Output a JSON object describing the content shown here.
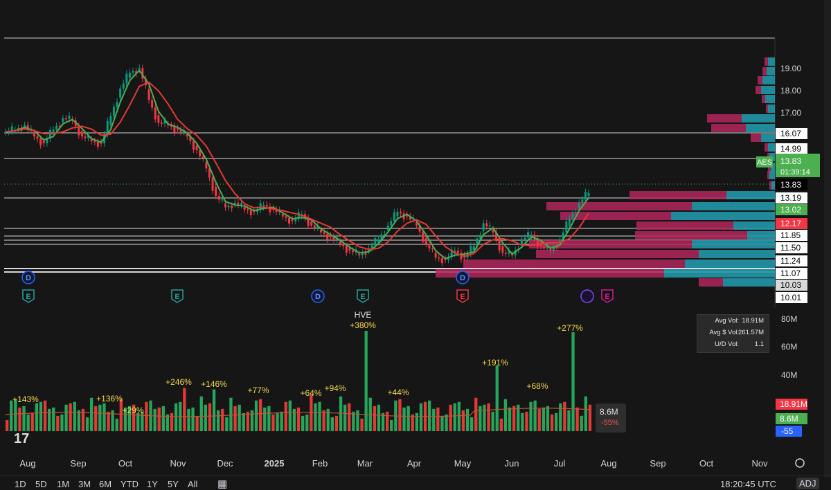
{
  "colors": {
    "up": "#26a69a",
    "down": "#ef5350",
    "upBar": "#089981",
    "downBar": "#f23645",
    "green": "#4caf50",
    "red": "#f23645",
    "ma_fast": "#4caf50",
    "ma_slow": "#e53935",
    "vp_up": "#2196a8",
    "vp_down": "#b0265c",
    "bg": "#161616",
    "blue": "#2962ff",
    "pink": "#d81b9b"
  },
  "symbol": "AES",
  "price": {
    "last": "13.83",
    "countdown": "01:39:14"
  },
  "chart_data": {
    "type": "line",
    "ylim": [
      9.7,
      20.0
    ],
    "x_months": [
      "Aug",
      "Sep",
      "Oct",
      "Nov",
      "Dec",
      "2025",
      "Feb",
      "Mar",
      "Apr",
      "May",
      "Jun",
      "Jul",
      "Aug",
      "Sep",
      "Oct",
      "Nov"
    ],
    "close_series": [
      16.5,
      16.6,
      16.8,
      16.3,
      16.0,
      16.6,
      17.1,
      17.0,
      16.3,
      16.1,
      16.0,
      17.2,
      18.4,
      19.1,
      19.3,
      17.9,
      16.9,
      16.8,
      16.6,
      16.3,
      15.7,
      14.9,
      13.7,
      13.2,
      13.4,
      13.1,
      13.0,
      13.3,
      13.1,
      12.8,
      12.6,
      12.9,
      12.4,
      12.1,
      11.9,
      11.6,
      11.3,
      11.1,
      11.4,
      11.8,
      12.4,
      13.0,
      12.8,
      12.4,
      11.6,
      11.0,
      10.9,
      11.3,
      11.0,
      11.5,
      12.5,
      12.1,
      11.2,
      11.1,
      11.8,
      12.0,
      11.5,
      11.3,
      11.8,
      12.7,
      13.4,
      13.83
    ],
    "horizontal_levels": [
      16.07,
      14.99,
      13.19,
      12.17,
      11.85,
      11.7,
      11.5,
      11.24,
      11.07,
      11.0
    ],
    "price_labels": [
      "19.00",
      "18.00",
      "17.00",
      "16.07",
      "14.99",
      "13.83",
      "13.19",
      "13.02",
      "12.17",
      "11.85",
      "11.50",
      "11.24",
      "11.07",
      "10.03",
      "10.01"
    ],
    "volume": {
      "ylabels": [
        "80M",
        "60M",
        "40M"
      ],
      "last": "8.6M",
      "last_pct": "-55%",
      "avg": "18.91M",
      "last_label": "8.6M",
      "ud": "-55"
    },
    "volume_annotations": [
      "+143%",
      "+136%",
      "+29%",
      "+246%",
      "+146%",
      "+77%",
      "+64%",
      "+94%",
      "+380%",
      "+44%",
      "+191%",
      "+68%",
      "+277%"
    ],
    "hve_label": "HVE",
    "events": [
      "D",
      "E",
      "E",
      "D",
      "E",
      "D",
      "E",
      "E"
    ]
  },
  "stats": {
    "avg_vol_label": "Avg Vol:",
    "avg_vol": "18.91M",
    "avg_dollar_label": "Avg $ Vol:",
    "avg_dollar": "261.57M",
    "ud_label": "U/D Vol:",
    "ud": "1.1"
  },
  "timeframes": [
    "1D",
    "5D",
    "1M",
    "3M",
    "6M",
    "YTD",
    "1Y",
    "5Y",
    "All"
  ],
  "clock": "18:20:45 UTC",
  "adj": "ADJ"
}
